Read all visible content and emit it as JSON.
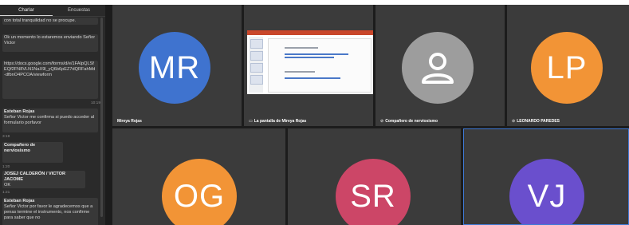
{
  "top_fragment": "jitsi",
  "chat": {
    "tabs": [
      {
        "label": "Charlar"
      },
      {
        "label": "Encuestas"
      }
    ],
    "messages": {
      "m1": "con total tranquilidad no se procupe.",
      "m2": "Ok un momento lo estaremos enviando Señor Victor",
      "m3": "https://docs.google.com/forms/d/e/1FAIpQLSfEQf2FN8VLN1NaX9l_yQ6b6pEZ7dQRFahMd-dfbnO4PCOA/viewform",
      "t3": "10:19",
      "s4": "Esteban Rojas",
      "m4": "Señor Victor me confirma si puedo acceder al formulario porfavor",
      "t4": "3:19",
      "s5": "Compañero de nerviosismo",
      "t5": "1:20",
      "s6": "JOSEJ CALDERÓN / VICTOR JACOME",
      "m6": "OK",
      "t6": "1:21",
      "s7": "Esteban Rojas",
      "m7": "Señor Victor por favor le agradecemos que a penas termine el instrumento, nos confirme para saber que no"
    }
  },
  "tiles": [
    {
      "initials": "MR",
      "name": "Mireya Rojas",
      "color": "#3f73cf"
    },
    {
      "initials": "",
      "name": "La pantalla de Mireya Rojas",
      "name_icon": "screen-share-icon"
    },
    {
      "initials": "",
      "name": "Compañero de nerviosismo",
      "name_icon": "muted-mic-icon",
      "color": "#9d9d9d"
    },
    {
      "initials": "LP",
      "name": "LEONARDO PAREDES",
      "name_icon": "muted-mic-icon",
      "color": "#f29436"
    },
    {
      "initials": "OG",
      "name": "",
      "color": "#f29436"
    },
    {
      "initials": "SR",
      "name": "",
      "color": "#cc4667"
    },
    {
      "initials": "VJ",
      "name": "",
      "color": "#6a4fcd"
    }
  ],
  "colors": {
    "active_speaker_border": "#3e79d6",
    "background": "#1c1c1c",
    "tile": "#3b3b3b"
  }
}
